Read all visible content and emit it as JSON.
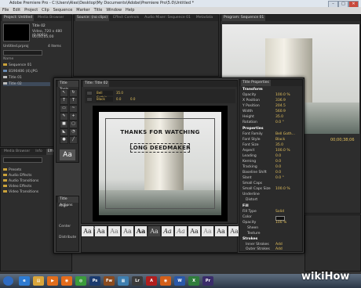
{
  "window": {
    "title": "Adobe Premiere Pro - C:\\Users\\Alex\\Desktop\\My Documents\\Adobe\\Premiere Pro\\5.0\\Untitled *",
    "minimize": "–",
    "maximize": "□",
    "close": "✕"
  },
  "menu": [
    "File",
    "Edit",
    "Project",
    "Clip",
    "Sequence",
    "Marker",
    "Title",
    "Window",
    "Help"
  ],
  "project": {
    "tabs": [
      "Project: Untitled",
      "Media Browser"
    ],
    "clip_name": "Title 02",
    "clip_info": "Video, 720 x 480 (0.9091)",
    "clip_duration": "00;00;05;00",
    "project_file": "Untitled.prproj",
    "item_count": "4 Items",
    "list_header": "Name",
    "items": [
      "Sequence 01",
      "8190406 (4).JPG",
      "Title 01",
      "Title 02"
    ]
  },
  "source": {
    "tabs": [
      "Source: (no clips)",
      "Effect Controls",
      "Audio Mixer: Sequence 01",
      "Metadata"
    ]
  },
  "program": {
    "tab": "Program: Sequence 01",
    "timecode": "00;00;38;06"
  },
  "effects": {
    "tabs": [
      "Media Browser",
      "Info",
      "Effects"
    ],
    "folders": [
      "Presets",
      "Audio Effects",
      "Audio Transitions",
      "Video Effects",
      "Video Transitions"
    ]
  },
  "title_tools": {
    "tab": "Title Tools"
  },
  "title_actions": {
    "tab": "Title Actions",
    "align": "Align",
    "center": "Center",
    "distribute": "Distribute"
  },
  "title_panel": {
    "tab": "Title: Title 02",
    "font": "Bell Gothic...",
    "style": "Black",
    "size": "35.0",
    "kerning": "0.0",
    "leading": "0.0"
  },
  "title_styles": {
    "tab": "Title Styles",
    "swatches": [
      "Aa",
      "Aa",
      "Aa",
      "Aa",
      "Aa",
      "Aa",
      "Aa",
      "Aa",
      "Aa",
      "Aa",
      "Aa",
      "Aa"
    ]
  },
  "canvas": {
    "line1": "THANKS FOR WATCHING",
    "line2": "LONG DEEDMAKER"
  },
  "title_properties": {
    "tab": "Title Properties",
    "transform_header": "Transform",
    "transform": [
      {
        "label": "Opacity",
        "value": "100.0 %"
      },
      {
        "label": "X Position",
        "value": "336.9"
      },
      {
        "label": "Y Position",
        "value": "204.5"
      },
      {
        "label": "Width",
        "value": "560.9"
      },
      {
        "label": "Height",
        "value": "35.0"
      },
      {
        "label": "Rotation",
        "value": "0.0 °"
      }
    ],
    "properties_header": "Properties",
    "properties": [
      {
        "label": "Font Family",
        "value": "Bell Goth..."
      },
      {
        "label": "Font Style",
        "value": "Black"
      },
      {
        "label": "Font Size",
        "value": "35.0"
      },
      {
        "label": "Aspect",
        "value": "100.0 %"
      },
      {
        "label": "Leading",
        "value": "0.0"
      },
      {
        "label": "Kerning",
        "value": "0.0"
      },
      {
        "label": "Tracking",
        "value": "0.0"
      },
      {
        "label": "Baseline Shift",
        "value": "0.0"
      },
      {
        "label": "Slant",
        "value": "0.0 °"
      },
      {
        "label": "Small Caps",
        "value": ""
      },
      {
        "label": "Small Caps Size",
        "value": "100.0 %"
      },
      {
        "label": "Underline",
        "value": ""
      },
      {
        "label": "Distort",
        "value": ""
      }
    ],
    "fill_header": "Fill",
    "fill": [
      {
        "label": "Fill Type",
        "value": "Solid"
      },
      {
        "label": "Color",
        "value": ""
      },
      {
        "label": "Opacity",
        "value": "100 %"
      },
      {
        "label": "Sheen",
        "value": ""
      },
      {
        "label": "Texture",
        "value": ""
      }
    ],
    "strokes_header": "Strokes",
    "strokes": [
      {
        "label": "Inner Strokes",
        "value": "Add"
      },
      {
        "label": "Outer Strokes",
        "value": "Add"
      }
    ]
  },
  "taskbar": {
    "icons": [
      {
        "name": "start-orb-icon",
        "label": "",
        "color": "#2f6bc0"
      },
      {
        "name": "ie-icon",
        "label": "e",
        "color": "#2e7bd1"
      },
      {
        "name": "explorer-icon",
        "label": "▤",
        "color": "#d9a53a"
      },
      {
        "name": "media-player-icon",
        "label": "▶",
        "color": "#e06d1c"
      },
      {
        "name": "firefox-icon",
        "label": "◉",
        "color": "#e36b1b"
      },
      {
        "name": "chrome-icon",
        "label": "◍",
        "color": "#3b9b3b"
      },
      {
        "name": "photoshop-icon",
        "label": "Ps",
        "color": "#1b3b6e"
      },
      {
        "name": "fireworks-icon",
        "label": "Fw",
        "color": "#8a4b1f"
      },
      {
        "name": "paint-icon",
        "label": "▦",
        "color": "#3f7fb0"
      },
      {
        "name": "lightroom-icon",
        "label": "Lr",
        "color": "#3b3b3b"
      },
      {
        "name": "acrobat-icon",
        "label": "A",
        "color": "#b01e1e"
      },
      {
        "name": "firefox2-icon",
        "label": "◉",
        "color": "#d35f1a"
      },
      {
        "name": "word-icon",
        "label": "W",
        "color": "#2a58a8"
      },
      {
        "name": "excel-icon",
        "label": "X",
        "color": "#2f7d3c"
      },
      {
        "name": "premiere-icon",
        "label": "Pr",
        "color": "#3a2c6a"
      }
    ]
  },
  "watermark": "wikiHow",
  "colors": {
    "accent_value": "#e3c05c",
    "panel": "#2d2d2d",
    "titlebar": "#dfe6ee"
  }
}
